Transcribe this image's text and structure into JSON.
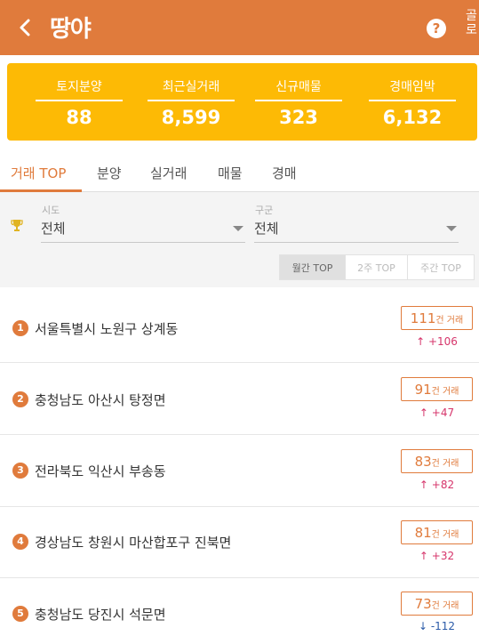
{
  "header": {
    "brand": "땅야",
    "help_glyph": "?",
    "edge_text": "골로"
  },
  "summary": [
    {
      "label": "토지분양",
      "value": "88"
    },
    {
      "label": "최근실거래",
      "value": "8,599"
    },
    {
      "label": "신규매물",
      "value": "323"
    },
    {
      "label": "경매임박",
      "value": "6,132"
    }
  ],
  "tabs": [
    {
      "label": "거래 TOP",
      "active": true
    },
    {
      "label": "분양",
      "active": false
    },
    {
      "label": "실거래",
      "active": false
    },
    {
      "label": "매물",
      "active": false
    },
    {
      "label": "경매",
      "active": false
    }
  ],
  "filters": {
    "sido_label": "시도",
    "sido_value": "전체",
    "gugun_label": "구군",
    "gugun_value": "전체",
    "periods": [
      {
        "label": "월간 TOP",
        "selected": true
      },
      {
        "label": "2주 TOP",
        "selected": false
      },
      {
        "label": "주간 TOP",
        "selected": false
      }
    ]
  },
  "rankings": [
    {
      "rank": "1",
      "region": "서울특별시 노원구 상계동",
      "count": "111",
      "unit": "건 거래",
      "direction": "up",
      "delta": "+106"
    },
    {
      "rank": "2",
      "region": "충청남도 아산시 탕정면",
      "count": "91",
      "unit": "건 거래",
      "direction": "up",
      "delta": "+47"
    },
    {
      "rank": "3",
      "region": "전라북도 익산시 부송동",
      "count": "83",
      "unit": "건 거래",
      "direction": "up",
      "delta": "+82"
    },
    {
      "rank": "4",
      "region": "경상남도 창원시 마산합포구 진북면",
      "count": "81",
      "unit": "건 거래",
      "direction": "up",
      "delta": "+32"
    },
    {
      "rank": "5",
      "region": "충청남도 당진시 석문면",
      "count": "73",
      "unit": "건 거래",
      "direction": "down",
      "delta": "-112"
    }
  ],
  "colors": {
    "header": "#e07b3c",
    "summary": "#fdba05",
    "accent": "#e07b3c",
    "up": "#d6356b",
    "down": "#2a5aa8"
  }
}
